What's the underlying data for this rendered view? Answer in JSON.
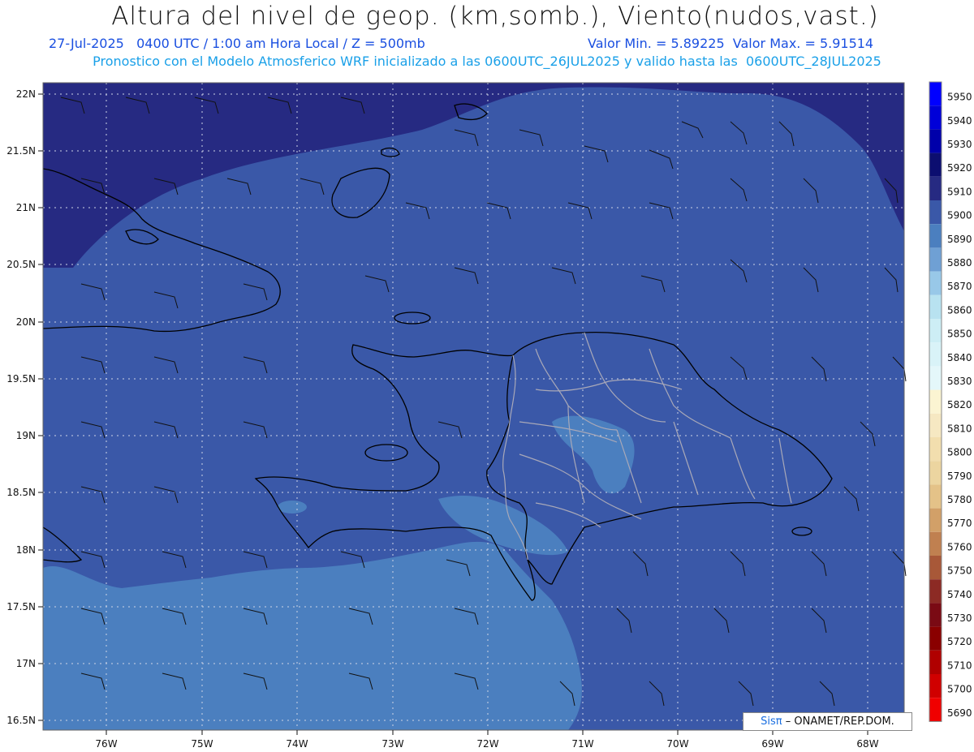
{
  "header": {
    "title": "Altura del nivel de geop. (km,somb.), Viento(nudos,vast.)",
    "date_line": "27-Jul-2025   0400 UTC / 1:00 am Hora Local / Z = 500mb",
    "min_max": "Valor Min. = 5.89225  Valor Max. = 5.91514",
    "model_line": "Pronostico con el Modelo Atmosferico WRF inicializado a las 0600UTC_26JUL2025 y valido hasta las  0600UTC_28JUL2025"
  },
  "map": {
    "lat_labels": [
      "22N",
      "21.5N",
      "21N",
      "20.5N",
      "20N",
      "19.5N",
      "19N",
      "18.5N",
      "18N",
      "17.5N",
      "17N",
      "16.5N"
    ],
    "lon_labels": [
      "76W",
      "75W",
      "74W",
      "73W",
      "72W",
      "71W",
      "70W",
      "69W",
      "68W"
    ],
    "colors": {
      "ocean_dark": "#262a82",
      "mid": "#3a58a8",
      "light": "#4e80c2",
      "lighter": "#5a90cc",
      "coast": "#000000",
      "borders": "#a8a8b8"
    }
  },
  "colorbar": {
    "labels": [
      "5950",
      "5940",
      "5930",
      "5920",
      "5910",
      "5900",
      "5890",
      "5880",
      "5870",
      "5860",
      "5850",
      "5840",
      "5830",
      "5820",
      "5810",
      "5800",
      "5790",
      "5780",
      "5770",
      "5760",
      "5750",
      "5740",
      "5730",
      "5720",
      "5710",
      "5700",
      "5690"
    ],
    "colors": [
      "#0000ff",
      "#0000d8",
      "#0000aa",
      "#0c0e70",
      "#262a82",
      "#3a58a8",
      "#4b7fbf",
      "#6fa0d4",
      "#98c8e8",
      "#b8e2f0",
      "#cdeef5",
      "#d9f3f8",
      "#e4f7fa",
      "#fbf4d2",
      "#f6e8c2",
      "#f2deae",
      "#ecd5a0",
      "#e4c288",
      "#d2a068",
      "#c08050",
      "#a85838",
      "#8c2a24",
      "#7a0a14",
      "#8a0000",
      "#b00000",
      "#d00000",
      "#f00000"
    ]
  },
  "credit": {
    "brand": "Sisπ",
    "text": "– ONAMET/REP.DOM."
  }
}
